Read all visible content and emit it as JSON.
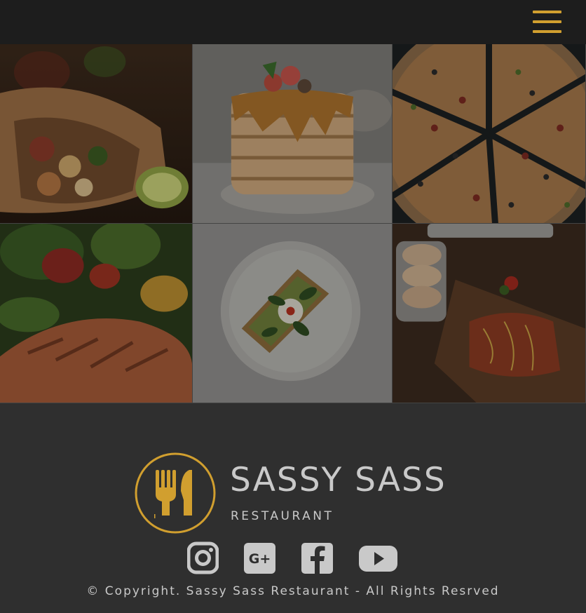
{
  "header": {
    "menu_label": "Menu",
    "accent_color": "#d19f2f"
  },
  "gallery": {
    "items": [
      {
        "label": "burrito"
      },
      {
        "label": "pancakes"
      },
      {
        "label": "pizza"
      },
      {
        "label": "salmon salad"
      },
      {
        "label": "avocado toast"
      },
      {
        "label": "grilled salmon board"
      }
    ]
  },
  "footer": {
    "logo_name": "SASSY SASS",
    "logo_sub": "RESTAURANT",
    "social": [
      {
        "icon": "instagram-icon"
      },
      {
        "icon": "google-plus-icon"
      },
      {
        "icon": "facebook-icon"
      },
      {
        "icon": "youtube-icon"
      }
    ],
    "copyright": "© Copyright. Sassy Sass Restaurant - All Rights Resrved"
  }
}
